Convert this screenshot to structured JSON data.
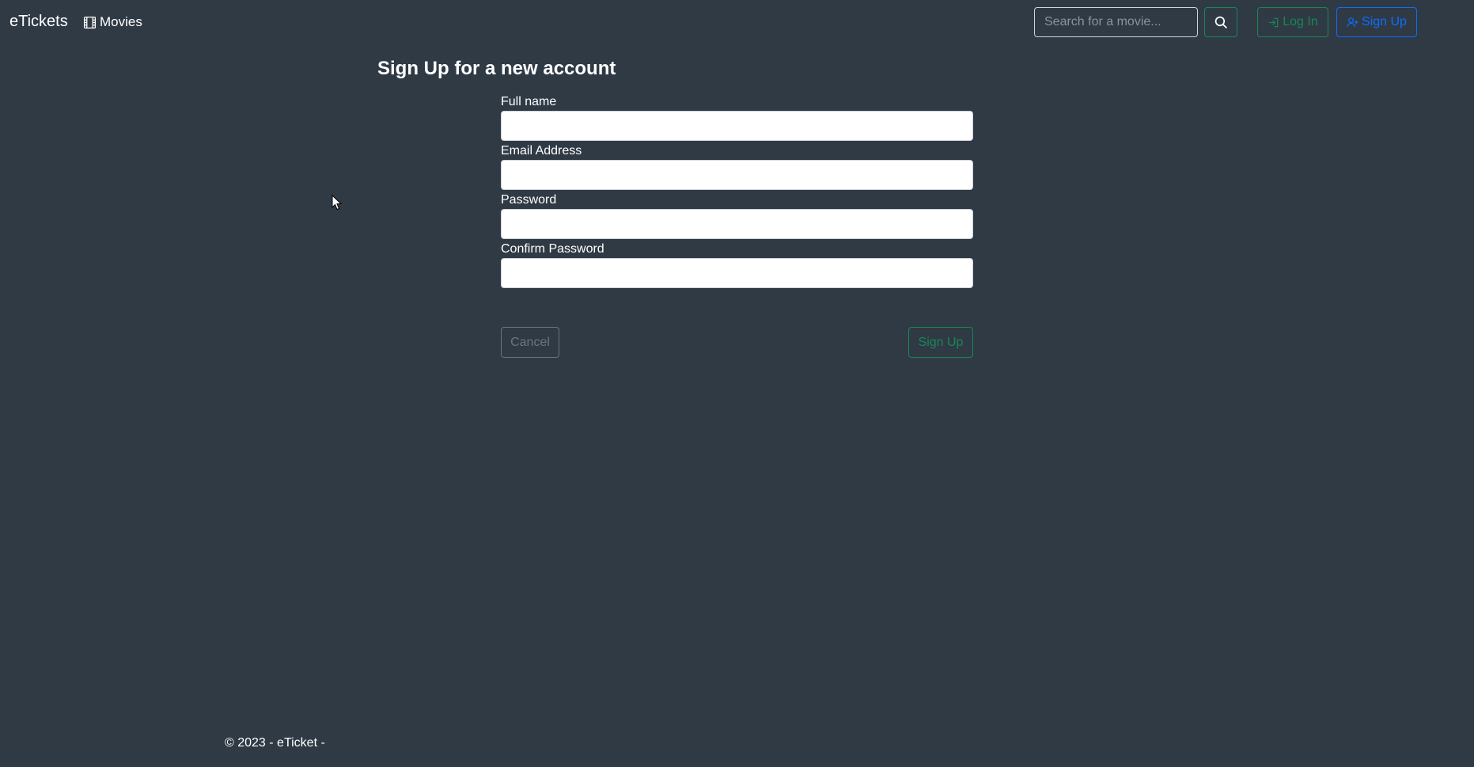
{
  "navbar": {
    "brand": "eTickets",
    "movies_label": "Movies",
    "movies_icon": "film-icon",
    "search": {
      "placeholder": "Search for a movie...",
      "value": ""
    },
    "search_icon": "search-icon",
    "login_label": "Log In",
    "login_icon": "login-icon",
    "signup_label": "Sign Up",
    "signup_icon": "person-plus-icon"
  },
  "page": {
    "title": "Sign Up for a new account"
  },
  "form": {
    "fields": [
      {
        "label": "Full name",
        "value": ""
      },
      {
        "label": "Email Address",
        "value": ""
      },
      {
        "label": "Password",
        "value": ""
      },
      {
        "label": "Confirm Password",
        "value": ""
      }
    ],
    "cancel_label": "Cancel",
    "submit_label": "Sign Up"
  },
  "footer": {
    "text": "© 2023 - eTicket -"
  },
  "colors": {
    "background": "#2f3a45",
    "success": "#198754",
    "primary": "#0d6efd",
    "secondary": "#6c757d"
  }
}
